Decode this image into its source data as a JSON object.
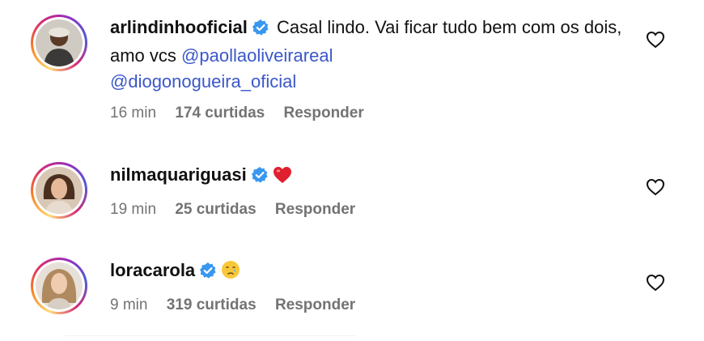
{
  "comments": [
    {
      "username": "arlindinhooficial",
      "text_before": " Casal lindo. Vai ficar tudo bem com os dois, amo vcs ",
      "mention_1": "@paollaoliveirareal",
      "mention_2": "@diogonogueira_oficial",
      "time": "16 min",
      "likes": "174 curtidas",
      "reply": "Responder"
    },
    {
      "username": "nilmaquariguasi",
      "emoji": "heart-emoji",
      "time": "19 min",
      "likes": "25 curtidas",
      "reply": "Responder"
    },
    {
      "username": "loracarola",
      "emoji": "crying-face-emoji",
      "time": "9 min",
      "likes": "319 curtidas",
      "reply": "Responder"
    }
  ],
  "icons": {
    "verified": "verified-badge-icon",
    "like": "heart-outline-icon"
  },
  "colors": {
    "mention": "#3a57c9",
    "verified": "#3897f0",
    "meta": "#737373"
  }
}
